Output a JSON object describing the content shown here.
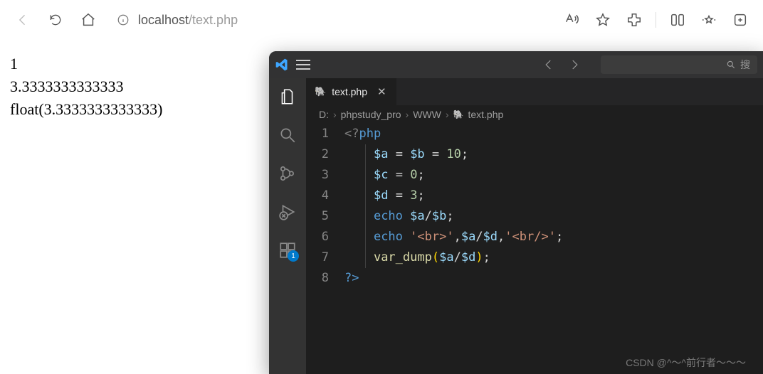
{
  "browser": {
    "url_host": "localhost",
    "url_path": "/text.php",
    "search_placeholder": "搜"
  },
  "page_output": {
    "line1": "1",
    "line2": "3.3333333333333",
    "line3": "float(3.3333333333333)"
  },
  "vscode": {
    "tab": {
      "filename": "text.php"
    },
    "breadcrumb": {
      "seg1": "D:",
      "seg2": "phpstudy_pro",
      "seg3": "WWW",
      "seg4": "text.php"
    },
    "badge": "1",
    "line_numbers": [
      "1",
      "2",
      "3",
      "4",
      "5",
      "6",
      "7",
      "8"
    ],
    "code": {
      "l1": {
        "open": "<?",
        "kw": "php"
      },
      "l2": {
        "va": "$a",
        "vb": "$b",
        "val": "10"
      },
      "l3": {
        "vc": "$c",
        "val": "0"
      },
      "l4": {
        "vd": "$d",
        "val": "3"
      },
      "l5": {
        "echo": "echo",
        "va": "$a",
        "vb": "$b"
      },
      "l6": {
        "echo": "echo",
        "s1": "'<br>'",
        "va": "$a",
        "vd": "$d",
        "s2": "'<br/>'"
      },
      "l7": {
        "fn": "var_dump",
        "va": "$a",
        "vd": "$d"
      },
      "l8": {
        "close": "?>"
      }
    }
  },
  "watermark": "CSDN @^～^前行者～～～"
}
